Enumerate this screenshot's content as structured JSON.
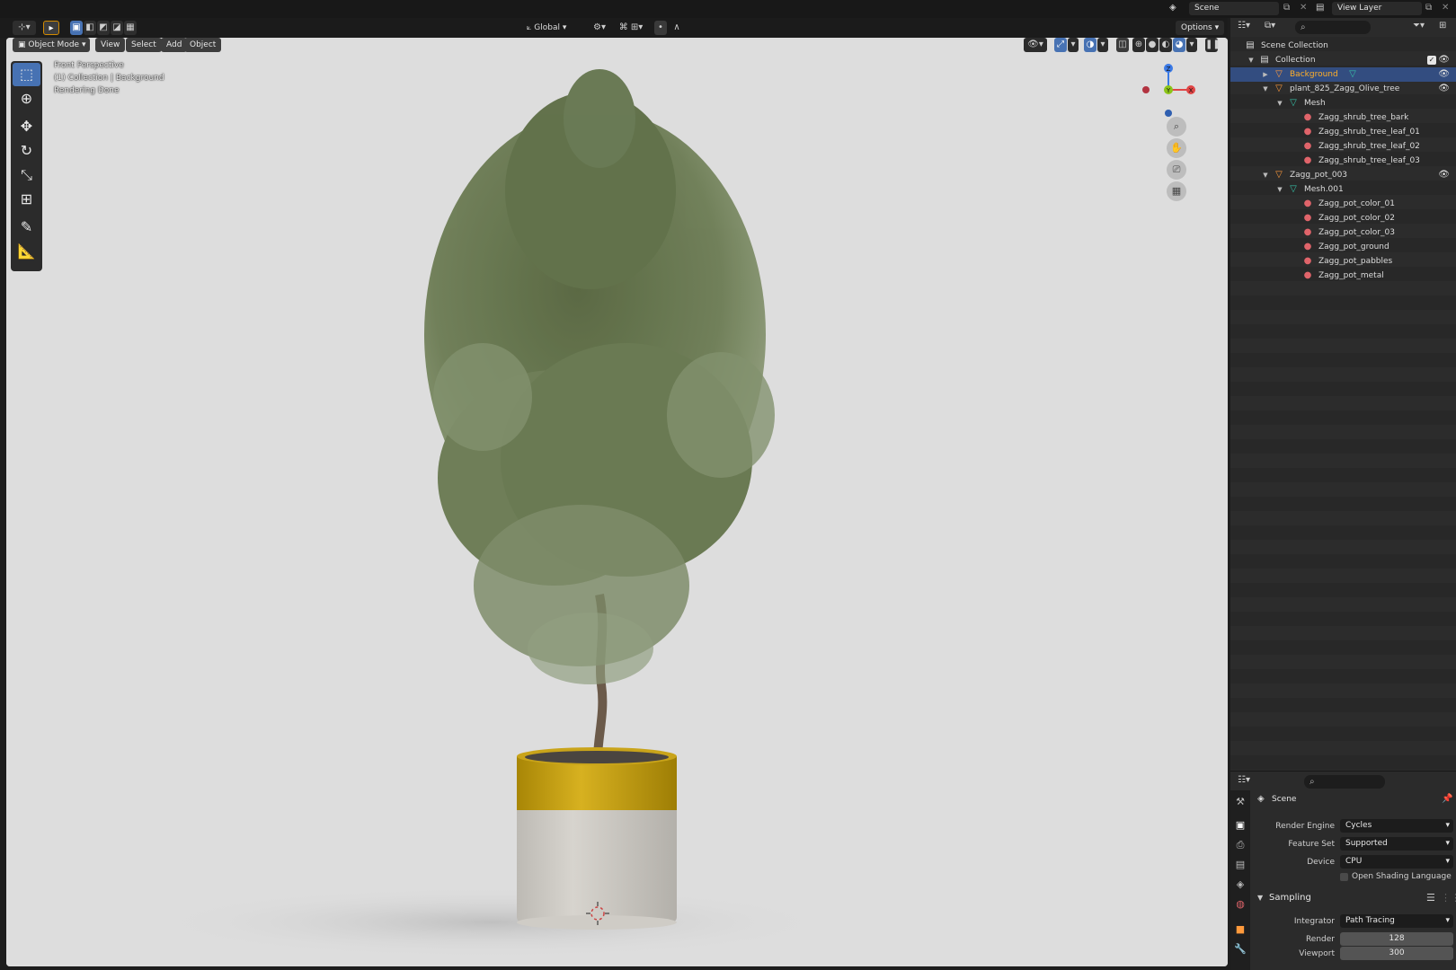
{
  "topbar": {
    "scene": "Scene",
    "view_layer": "View Layer"
  },
  "vp_header": {
    "mode": "Object Mode",
    "menus": [
      "View",
      "Select",
      "Add",
      "Object"
    ],
    "orientation": "Global",
    "options": "Options"
  },
  "overlay": {
    "view_name": "Front Perspective",
    "context": "(1) Collection | Background",
    "status": "Rendering Done"
  },
  "gizmo": {
    "z": "Z",
    "y": "Y",
    "x": "X"
  },
  "outliner": {
    "scene_collection": "Scene Collection",
    "rows": [
      {
        "label": "Collection"
      },
      {
        "label": "Background"
      },
      {
        "label": "plant_825_Zagg_Olive_tree"
      },
      {
        "label": "Mesh"
      },
      {
        "label": "Zagg_shrub_tree_bark"
      },
      {
        "label": "Zagg_shrub_tree_leaf_01"
      },
      {
        "label": "Zagg_shrub_tree_leaf_02"
      },
      {
        "label": "Zagg_shrub_tree_leaf_03"
      },
      {
        "label": "Zagg_pot_003"
      },
      {
        "label": "Mesh.001"
      },
      {
        "label": "Zagg_pot_color_01"
      },
      {
        "label": "Zagg_pot_color_02"
      },
      {
        "label": "Zagg_pot_color_03"
      },
      {
        "label": "Zagg_pot_ground"
      },
      {
        "label": "Zagg_pot_pabbles"
      },
      {
        "label": "Zagg_pot_metal"
      }
    ]
  },
  "properties": {
    "context": "Scene",
    "render_engine_label": "Render Engine",
    "render_engine": "Cycles",
    "feature_set_label": "Feature Set",
    "feature_set": "Supported",
    "device_label": "Device",
    "device": "CPU",
    "osl_label": "Open Shading Language",
    "sampling_label": "Sampling",
    "integrator_label": "Integrator",
    "integrator": "Path Tracing",
    "render_label": "Render",
    "render_samples": "128",
    "viewport_label": "Viewport",
    "viewport_samples": "300"
  },
  "colors": {
    "accent": "#4772b3",
    "selected_object": "#ffaf29",
    "viewport_bg": "#dddddd",
    "pot_band": "#c9a10c"
  }
}
